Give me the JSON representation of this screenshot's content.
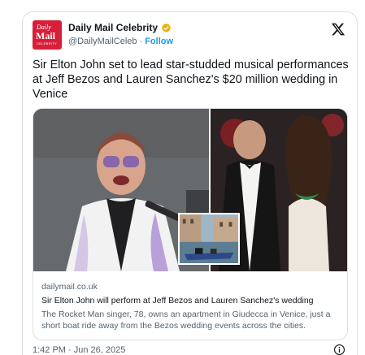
{
  "account": {
    "avatar_text_1": "Daily",
    "avatar_text_2": "Mail",
    "avatar_text_3": "CELEBRITY",
    "display_name": "Daily Mail Celebrity",
    "handle": "@DailyMailCeleb",
    "separator": "·",
    "follow_label": "Follow",
    "verified_color": "#e8b10a",
    "brand_color": "#d81f3a"
  },
  "tweet": {
    "text": "Sir Elton John set to lead star-studded musical performances at Jeff Bezos and Lauren Sanchez's $20 million wedding in Venice",
    "timestamp": "1:42 PM · Jun 26, 2025"
  },
  "link_card": {
    "domain": "dailymail.co.uk",
    "title": "Sir Elton John will perform at Jeff Bezos and Lauren Sanchez's wedding",
    "description": "The Rocket Man singer, 78, owns an apartment in Giudecca in Venice, just a short boat ride away from the Bezos wedding events across the cities."
  },
  "icons": {
    "platform_logo": "x-logo-icon",
    "verified": "verified-badge-icon",
    "info": "info-icon"
  },
  "colors": {
    "link_blue": "#1d9bf0",
    "secondary_text": "#536471",
    "border": "#dcdfe3"
  }
}
